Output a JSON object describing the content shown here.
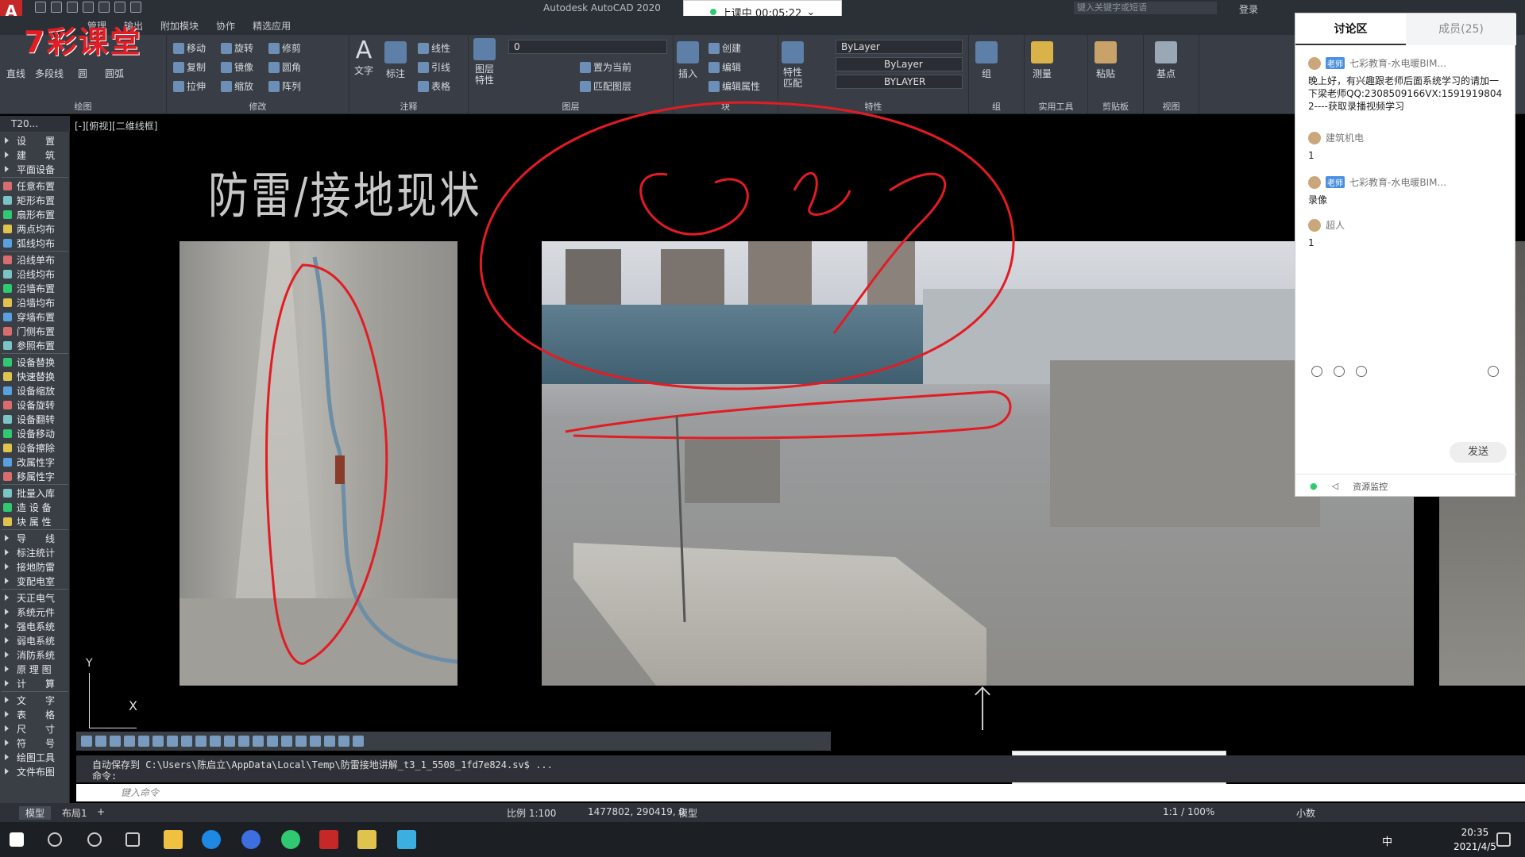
{
  "window": {
    "app_title": "Autodesk AutoCAD 2020",
    "logo_letter": "A",
    "watermark": "7彩课堂",
    "search_placeholder": "键入关键字或短语",
    "login": "登录"
  },
  "class_timer": {
    "label": "上课中 00:05:22"
  },
  "menu": [
    "管理",
    "输出",
    "附加模块",
    "协作",
    "精选应用"
  ],
  "ribbon": {
    "draw": {
      "title": "绘图",
      "line": "直线",
      "polyline": "多段线",
      "circle": "圆",
      "arc": "圆弧"
    },
    "modify": {
      "title": "修改",
      "move": "移动",
      "rotate": "旋转",
      "trim": "修剪",
      "copy": "复制",
      "mirror": "镜像",
      "fillet": "圆角",
      "stretch": "拉伸",
      "scale": "缩放",
      "array": "阵列"
    },
    "annotation": {
      "title": "注释",
      "text": "文字",
      "dimension": "标注",
      "linear": "线性",
      "leader": "引线",
      "table": "表格"
    },
    "layers": {
      "title": "图层",
      "layer_props": "图层特性",
      "current_layer": "0",
      "make_current": "置为当前",
      "match_layer": "匹配图层"
    },
    "block": {
      "title": "块",
      "insert": "插入",
      "create": "创建",
      "edit": "编辑",
      "edit_attr": "编辑属性"
    },
    "properties": {
      "title": "特性",
      "match": "特性匹配",
      "color": "ByLayer",
      "linetype": "ByLayer",
      "lineweight": "BYLAYER"
    },
    "groups": {
      "title": "组",
      "group": "组"
    },
    "utilities": {
      "title": "实用工具",
      "measure": "测量"
    },
    "clipboard": {
      "title": "剪贴板",
      "paste": "粘贴"
    },
    "view": {
      "title": "视图",
      "base": "基点"
    }
  },
  "palette": {
    "header": "T20...",
    "items": [
      "设　　置",
      "建　　筑",
      "平面设备",
      "任意布置",
      "矩形布置",
      "扇形布置",
      "两点均布",
      "弧线均布",
      "沿线单布",
      "沿线均布",
      "沿墙布置",
      "沿墙均布",
      "穿墙布置",
      "门侧布置",
      "参照布置",
      "设备替换",
      "快速替换",
      "设备缩放",
      "设备旋转",
      "设备翻转",
      "设备移动",
      "设备擦除",
      "改属性字",
      "移属性字",
      "批量入库",
      "造 设 备",
      "块 属 性",
      "导　　线",
      "标注统计",
      "接地防雷",
      "变配电室",
      "天正电气",
      "系统元件",
      "强电系统",
      "弱电系统",
      "消防系统",
      "原 理 图",
      "计　　算",
      "文　　字",
      "表　　格",
      "尺　　寸",
      "符　　号",
      "绘图工具",
      "文件布图"
    ]
  },
  "drawing": {
    "viewport_label": "[-][俯视][二维线框]",
    "title": "防雷/接地现状",
    "axis_y": "Y",
    "axis_x": "X"
  },
  "chat": {
    "tab_discuss": "讨论区",
    "tab_members": "成员(25)",
    "messages": [
      {
        "sender": "七彩教育-水电暖BIM...",
        "tag": "老师",
        "text": "晚上好，有兴趣跟老师后面系统学习的请加一下梁老师QQ:2308509166VX:15919198042----获取录播视频学习"
      },
      {
        "sender": "建筑机电",
        "tag": "",
        "text": "1"
      },
      {
        "sender": "七彩教育-水电暖BIM...",
        "tag": "老师",
        "text": "录像"
      },
      {
        "sender": "超人",
        "tag": "",
        "text": "1"
      }
    ],
    "send": "发送",
    "resource_monitor": "资源监控"
  },
  "command": {
    "history": "自动保存到 C:\\Users\\陈启立\\AppData\\Local\\Temp\\防雷接地讲解_t3_1_5508_1fd7e824.sv$ ...",
    "prompt": "命令:",
    "input_placeholder": "键入命令"
  },
  "status": {
    "model_tab": "模型",
    "layout_tab": "布局1",
    "scale": "比例 1:100",
    "coords": "1477802, 290419, 0",
    "model": "模型",
    "zoom": "1:1 / 100%",
    "units": "小数"
  },
  "taskbar": {
    "time": "20:35",
    "date": "2021/4/5",
    "ime": "中"
  },
  "colors": {
    "accent_red": "#e31b23",
    "ribbon_bg": "#393e46",
    "chat_online": "#2ec971"
  }
}
